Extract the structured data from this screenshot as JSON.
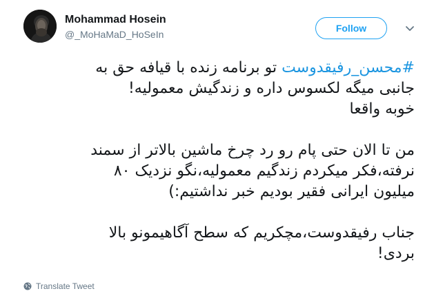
{
  "author": {
    "display_name": "Mohammad Hosein",
    "handle": "@_MoHaMaD_HoSeIn",
    "avatar_icon": "avatar-photo"
  },
  "actions": {
    "follow_label": "Follow",
    "menu_icon": "chevron-down-icon"
  },
  "tweet": {
    "hashtag": "#محسن_رفیقدوست",
    "line1_rest": " تو برنامه زنده با قیافه حق به",
    "line2": "جانبی میگه لکسوس داره و زندگیش معمولیه!",
    "line3": "خوبه واقعا",
    "para2_line1": "من تا الان حتی پام رو رد چرخ ماشین بالاتر از سمند",
    "para2_line2": "نرفته،فکر میکردم زندگیم معمولیه،نگو نزدیک ۸۰",
    "para2_line3": "میلیون ایرانی فقیر بودیم خبر نداشتیم:)",
    "para3_line1": "جناب رفیقدوست،مچکریم که سطح آگاهیمونو بالا",
    "para3_line2": "بردی!"
  },
  "footer": {
    "translate_label": "Translate Tweet",
    "translate_icon": "globe-icon"
  },
  "colors": {
    "accent": "#1da1f2",
    "hashtag": "#1b95e0",
    "secondary_text": "#657786",
    "primary_text": "#14171a"
  }
}
